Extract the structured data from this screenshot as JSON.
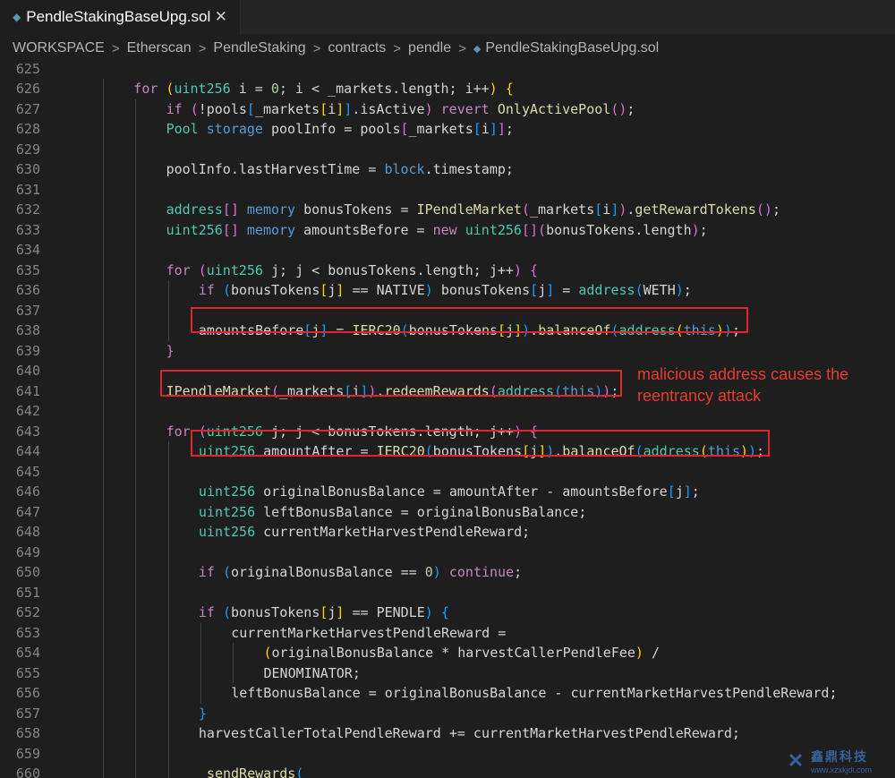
{
  "tab": {
    "title": "PendleStakingBaseUpg.sol",
    "file_icon": "solidity-file-icon",
    "close_glyph": "✕"
  },
  "breadcrumb": {
    "items": [
      "WORKSPACE",
      "Etherscan",
      "PendleStaking",
      "contracts",
      "pendle"
    ],
    "file": "PendleStakingBaseUpg.sol",
    "separator": ">"
  },
  "editor": {
    "lines": [
      {
        "n": "625",
        "indent": 1,
        "tokens": []
      },
      {
        "n": "626",
        "indent": 2,
        "tokens": [
          [
            "k",
            "for "
          ],
          [
            "bk1",
            "("
          ],
          [
            "t",
            "uint256"
          ],
          [
            "v",
            " i = "
          ],
          [
            "n",
            "0"
          ],
          [
            "v",
            "; i < _markets.length; i++"
          ],
          [
            "bk1",
            ")"
          ],
          [
            "v",
            " "
          ],
          [
            "bk1",
            "{"
          ]
        ]
      },
      {
        "n": "627",
        "indent": 3,
        "tokens": [
          [
            "k",
            "if "
          ],
          [
            "bk2",
            "("
          ],
          [
            "v",
            "!pools"
          ],
          [
            "bk3",
            "["
          ],
          [
            "v",
            "_markets"
          ],
          [
            "bk1",
            "["
          ],
          [
            "v",
            "i"
          ],
          [
            "bk1",
            "]"
          ],
          [
            "bk3",
            "]"
          ],
          [
            "v",
            ".isActive"
          ],
          [
            "bk2",
            ")"
          ],
          [
            "v",
            " "
          ],
          [
            "k",
            "revert "
          ],
          [
            "f",
            "OnlyActivePool"
          ],
          [
            "bk2",
            "()"
          ],
          [
            "v",
            ";"
          ]
        ]
      },
      {
        "n": "628",
        "indent": 3,
        "tokens": [
          [
            "t",
            "Pool "
          ],
          [
            "b",
            "storage "
          ],
          [
            "v",
            "poolInfo = pools"
          ],
          [
            "bk2",
            "["
          ],
          [
            "v",
            "_markets"
          ],
          [
            "bk3",
            "["
          ],
          [
            "v",
            "i"
          ],
          [
            "bk3",
            "]"
          ],
          [
            "bk2",
            "]"
          ],
          [
            "v",
            ";"
          ]
        ]
      },
      {
        "n": "629",
        "indent": 3,
        "tokens": []
      },
      {
        "n": "630",
        "indent": 3,
        "tokens": [
          [
            "v",
            "poolInfo.lastHarvestTime = "
          ],
          [
            "b",
            "block"
          ],
          [
            "v",
            ".timestamp;"
          ]
        ]
      },
      {
        "n": "631",
        "indent": 3,
        "tokens": []
      },
      {
        "n": "632",
        "indent": 3,
        "tokens": [
          [
            "t",
            "address"
          ],
          [
            "bk2",
            "[]"
          ],
          [
            "v",
            " "
          ],
          [
            "b",
            "memory "
          ],
          [
            "v",
            "bonusTokens = "
          ],
          [
            "f",
            "IPendleMarket"
          ],
          [
            "bk2",
            "("
          ],
          [
            "v",
            "_markets"
          ],
          [
            "bk3",
            "["
          ],
          [
            "v",
            "i"
          ],
          [
            "bk3",
            "]"
          ],
          [
            "bk2",
            ")"
          ],
          [
            "v",
            "."
          ],
          [
            "f",
            "getRewardTokens"
          ],
          [
            "bk2",
            "()"
          ],
          [
            "v",
            ";"
          ]
        ]
      },
      {
        "n": "633",
        "indent": 3,
        "tokens": [
          [
            "t",
            "uint256"
          ],
          [
            "bk2",
            "[]"
          ],
          [
            "v",
            " "
          ],
          [
            "b",
            "memory "
          ],
          [
            "v",
            "amountsBefore = "
          ],
          [
            "k",
            "new "
          ],
          [
            "t",
            "uint256"
          ],
          [
            "bk2",
            "[]"
          ],
          [
            "bk2",
            "("
          ],
          [
            "v",
            "bonusTokens.length"
          ],
          [
            "bk2",
            ")"
          ],
          [
            "v",
            ";"
          ]
        ]
      },
      {
        "n": "634",
        "indent": 3,
        "tokens": []
      },
      {
        "n": "635",
        "indent": 3,
        "tokens": [
          [
            "k",
            "for "
          ],
          [
            "bk2",
            "("
          ],
          [
            "t",
            "uint256"
          ],
          [
            "v",
            " j; j < bonusTokens.length; j++"
          ],
          [
            "bk2",
            ")"
          ],
          [
            "v",
            " "
          ],
          [
            "bk2",
            "{"
          ]
        ]
      },
      {
        "n": "636",
        "indent": 4,
        "tokens": [
          [
            "k",
            "if "
          ],
          [
            "bk3",
            "("
          ],
          [
            "v",
            "bonusTokens"
          ],
          [
            "bk1",
            "["
          ],
          [
            "v",
            "j"
          ],
          [
            "bk1",
            "]"
          ],
          [
            "v",
            " == NATIVE"
          ],
          [
            "bk3",
            ")"
          ],
          [
            "v",
            " bonusTokens"
          ],
          [
            "bk3",
            "["
          ],
          [
            "v",
            "j"
          ],
          [
            "bk3",
            "]"
          ],
          [
            "v",
            " = "
          ],
          [
            "t",
            "address"
          ],
          [
            "bk3",
            "("
          ],
          [
            "v",
            "WETH"
          ],
          [
            "bk3",
            ")"
          ],
          [
            "v",
            ";"
          ]
        ]
      },
      {
        "n": "637",
        "indent": 4,
        "tokens": []
      },
      {
        "n": "638",
        "indent": 4,
        "tokens": [
          [
            "v",
            "amountsBefore"
          ],
          [
            "bk3",
            "["
          ],
          [
            "v",
            "j"
          ],
          [
            "bk3",
            "]"
          ],
          [
            "v",
            " = "
          ],
          [
            "f",
            "IERC20"
          ],
          [
            "bk3",
            "("
          ],
          [
            "v",
            "bonusTokens"
          ],
          [
            "bk1",
            "["
          ],
          [
            "v",
            "j"
          ],
          [
            "bk1",
            "]"
          ],
          [
            "bk3",
            ")"
          ],
          [
            "v",
            "."
          ],
          [
            "f",
            "balanceOf"
          ],
          [
            "bk3",
            "("
          ],
          [
            "t",
            "address"
          ],
          [
            "bk1",
            "("
          ],
          [
            "b",
            "this"
          ],
          [
            "bk1",
            ")"
          ],
          [
            "bk3",
            ")"
          ],
          [
            "v",
            ";"
          ]
        ]
      },
      {
        "n": "639",
        "indent": 3,
        "tokens": [
          [
            "bk2",
            "}"
          ]
        ]
      },
      {
        "n": "640",
        "indent": 3,
        "tokens": []
      },
      {
        "n": "641",
        "indent": 3,
        "tokens": [
          [
            "f",
            "IPendleMarket"
          ],
          [
            "bk2",
            "("
          ],
          [
            "v",
            "_markets"
          ],
          [
            "bk3",
            "["
          ],
          [
            "v",
            "i"
          ],
          [
            "bk3",
            "]"
          ],
          [
            "bk2",
            ")"
          ],
          [
            "v",
            "."
          ],
          [
            "f",
            "redeemRewards"
          ],
          [
            "bk2",
            "("
          ],
          [
            "t",
            "address"
          ],
          [
            "bk3",
            "("
          ],
          [
            "b",
            "this"
          ],
          [
            "bk3",
            ")"
          ],
          [
            "bk2",
            ")"
          ],
          [
            "v",
            ";"
          ]
        ]
      },
      {
        "n": "642",
        "indent": 3,
        "tokens": []
      },
      {
        "n": "643",
        "indent": 3,
        "tokens": [
          [
            "k",
            "for "
          ],
          [
            "bk2",
            "("
          ],
          [
            "t",
            "uint256"
          ],
          [
            "v",
            " j; j < bonusTokens.length; j++"
          ],
          [
            "bk2",
            ")"
          ],
          [
            "v",
            " "
          ],
          [
            "bk2",
            "{"
          ]
        ]
      },
      {
        "n": "644",
        "indent": 4,
        "tokens": [
          [
            "t",
            "uint256"
          ],
          [
            "v",
            " amountAfter = "
          ],
          [
            "f",
            "IERC20"
          ],
          [
            "bk3",
            "("
          ],
          [
            "v",
            "bonusTokens"
          ],
          [
            "bk1",
            "["
          ],
          [
            "v",
            "j"
          ],
          [
            "bk1",
            "]"
          ],
          [
            "bk3",
            ")"
          ],
          [
            "v",
            "."
          ],
          [
            "f",
            "balanceOf"
          ],
          [
            "bk3",
            "("
          ],
          [
            "t",
            "address"
          ],
          [
            "bk1",
            "("
          ],
          [
            "b",
            "this"
          ],
          [
            "bk1",
            ")"
          ],
          [
            "bk3",
            ")"
          ],
          [
            "v",
            ";"
          ]
        ]
      },
      {
        "n": "645",
        "indent": 4,
        "tokens": []
      },
      {
        "n": "646",
        "indent": 4,
        "tokens": [
          [
            "t",
            "uint256"
          ],
          [
            "v",
            " originalBonusBalance = amountAfter - amountsBefore"
          ],
          [
            "bk3",
            "["
          ],
          [
            "v",
            "j"
          ],
          [
            "bk3",
            "]"
          ],
          [
            "v",
            ";"
          ]
        ]
      },
      {
        "n": "647",
        "indent": 4,
        "tokens": [
          [
            "t",
            "uint256"
          ],
          [
            "v",
            " leftBonusBalance = originalBonusBalance;"
          ]
        ]
      },
      {
        "n": "648",
        "indent": 4,
        "tokens": [
          [
            "t",
            "uint256"
          ],
          [
            "v",
            " currentMarketHarvestPendleReward;"
          ]
        ]
      },
      {
        "n": "649",
        "indent": 4,
        "tokens": []
      },
      {
        "n": "650",
        "indent": 4,
        "tokens": [
          [
            "k",
            "if "
          ],
          [
            "bk3",
            "("
          ],
          [
            "v",
            "originalBonusBalance == "
          ],
          [
            "n",
            "0"
          ],
          [
            "bk3",
            ")"
          ],
          [
            "v",
            " "
          ],
          [
            "k",
            "continue"
          ],
          [
            "v",
            ";"
          ]
        ]
      },
      {
        "n": "651",
        "indent": 4,
        "tokens": []
      },
      {
        "n": "652",
        "indent": 4,
        "tokens": [
          [
            "k",
            "if "
          ],
          [
            "bk3",
            "("
          ],
          [
            "v",
            "bonusTokens"
          ],
          [
            "bk1",
            "["
          ],
          [
            "v",
            "j"
          ],
          [
            "bk1",
            "]"
          ],
          [
            "v",
            " == PENDLE"
          ],
          [
            "bk3",
            ")"
          ],
          [
            "v",
            " "
          ],
          [
            "bk3",
            "{"
          ]
        ]
      },
      {
        "n": "653",
        "indent": 5,
        "tokens": [
          [
            "v",
            "currentMarketHarvestPendleReward ="
          ]
        ]
      },
      {
        "n": "654",
        "indent": 6,
        "tokens": [
          [
            "bk1",
            "("
          ],
          [
            "v",
            "originalBonusBalance * harvestCallerPendleFee"
          ],
          [
            "bk1",
            ")"
          ],
          [
            "v",
            " /"
          ]
        ]
      },
      {
        "n": "655",
        "indent": 6,
        "tokens": [
          [
            "v",
            "DENOMINATOR;"
          ]
        ]
      },
      {
        "n": "656",
        "indent": 5,
        "tokens": [
          [
            "v",
            "leftBonusBalance = originalBonusBalance - currentMarketHarvestPendleReward;"
          ]
        ]
      },
      {
        "n": "657",
        "indent": 4,
        "tokens": [
          [
            "bk3",
            "}"
          ]
        ]
      },
      {
        "n": "658",
        "indent": 4,
        "tokens": [
          [
            "v",
            "harvestCallerTotalPendleReward += currentMarketHarvestPendleReward;"
          ]
        ]
      },
      {
        "n": "659",
        "indent": 4,
        "tokens": []
      },
      {
        "n": "660",
        "indent": 4,
        "tokens": [
          [
            "f",
            "_sendRewards"
          ],
          [
            "bk3",
            "("
          ]
        ]
      }
    ]
  },
  "annotation": {
    "text": "malicious address causes the reentrancy attack",
    "color": "#ea3b2e"
  },
  "highlight_color": "#e0252b",
  "watermark": {
    "title": "鑫鼎科技",
    "url": "www.xzxkjdi.com"
  }
}
